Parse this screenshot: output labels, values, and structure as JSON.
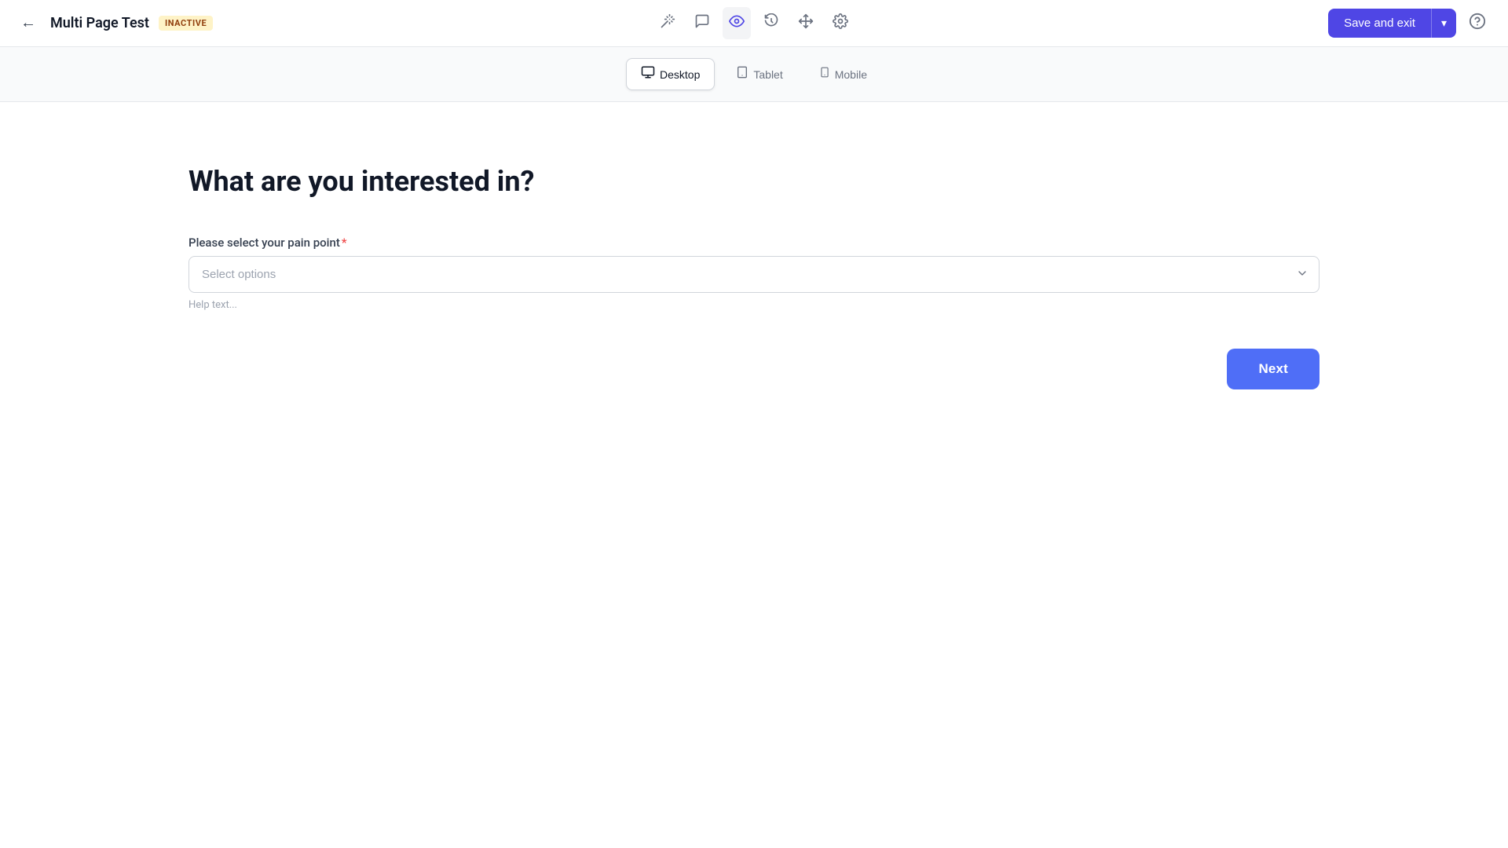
{
  "header": {
    "back_label": "←",
    "title": "Multi Page Test",
    "badge": "INACTIVE",
    "icons": [
      {
        "name": "magic-wand-icon",
        "symbol": "✦",
        "title": "Magic wand"
      },
      {
        "name": "chat-icon",
        "symbol": "💬",
        "title": "Comments"
      },
      {
        "name": "eye-icon",
        "symbol": "👁",
        "title": "Preview",
        "active": true
      },
      {
        "name": "history-icon",
        "symbol": "⏱",
        "title": "History"
      },
      {
        "name": "move-icon",
        "symbol": "✥",
        "title": "Move"
      },
      {
        "name": "settings-icon",
        "symbol": "⚙",
        "title": "Settings"
      }
    ],
    "save_exit_label": "Save and exit",
    "dropdown_arrow": "▾",
    "help_icon": "?"
  },
  "subheader": {
    "devices": [
      {
        "name": "desktop-tab",
        "label": "Desktop",
        "icon": "🖥",
        "active": true
      },
      {
        "name": "tablet-tab",
        "label": "Tablet",
        "icon": "⬜",
        "active": false
      },
      {
        "name": "mobile-tab",
        "label": "Mobile",
        "icon": "📱",
        "active": false
      }
    ]
  },
  "form": {
    "title": "What are you interested in?",
    "field_label": "Please select your pain point",
    "required": "*",
    "select_placeholder": "Select options",
    "help_text": "Help text...",
    "next_label": "Next"
  }
}
